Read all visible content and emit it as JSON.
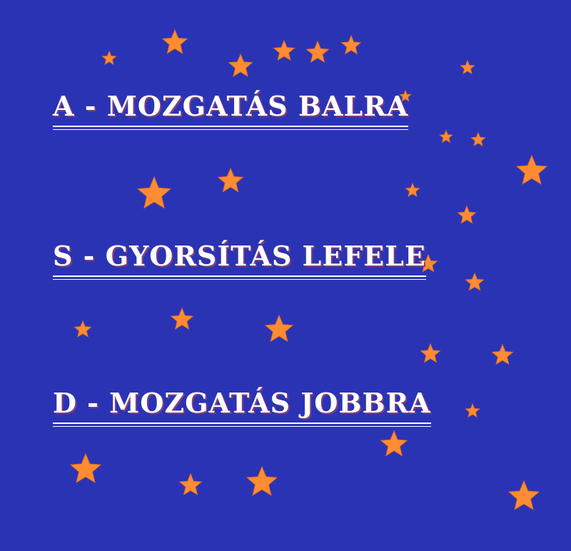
{
  "controls": [
    {
      "text": "A - MOZGATÁS BALRA"
    },
    {
      "text": "S - GYORSÍTÁS LEFELE"
    },
    {
      "text": "D - MOZGATÁS JOBBRA"
    }
  ],
  "colors": {
    "background": "#2b33b5",
    "star": "#ff8c33",
    "text": "#ffffff"
  },
  "decoration": {
    "icon": "star-icon"
  }
}
